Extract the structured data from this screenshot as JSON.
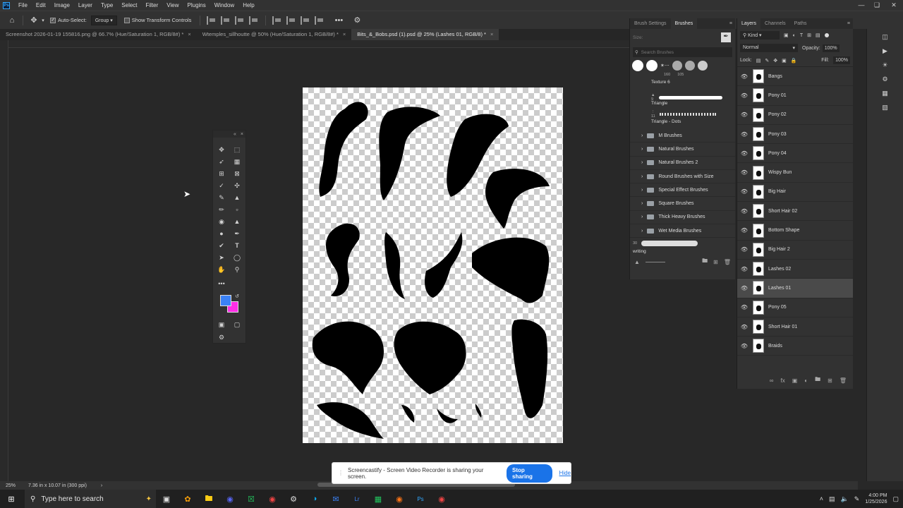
{
  "menu": {
    "logo": "Ps",
    "items": [
      "File",
      "Edit",
      "Image",
      "Layer",
      "Type",
      "Select",
      "Filter",
      "View",
      "Plugins",
      "Window",
      "Help"
    ]
  },
  "options_bar": {
    "auto_select_label": "Auto-Select:",
    "auto_select_target": "Group",
    "show_transform_label": "Show Transform Controls",
    "more_label": "•••"
  },
  "tabs": [
    {
      "label": "Screenshot 2026-01-19 155816.png @ 66.7% (Hue/Saturation 1, RGB/8#) *",
      "active": false
    },
    {
      "label": "Wtemples_sillhoutte @ 50% (Hue/Saturation 1, RGB/8#) *",
      "active": false
    },
    {
      "label": "Bits_&_Bobs.psd (1).psd @ 25% (Lashes 01, RGB/8) *",
      "active": true
    }
  ],
  "brushes": {
    "tabs": [
      "Brush Settings",
      "Brushes"
    ],
    "size_label": "Size:",
    "search_placeholder": "Search Brushes",
    "preset_sizes": [
      "160",
      "105"
    ],
    "texture_label": "Texture 6",
    "triangle_size": "9",
    "triangle_label": "Triangle",
    "dots_size": "11",
    "dots_label": "Triangle - Dots",
    "folders": [
      "M Brushes",
      "Natural Brushes",
      "Natural Brushes 2",
      "Round Brushes with Size",
      "Special Effect Brushes",
      "Square Brushes",
      "Thick Heavy Brushes",
      "Wet Media Brushes"
    ],
    "bottom_size": "30",
    "bottom_label": "writing"
  },
  "layers": {
    "tabs": [
      "Layers",
      "Channels",
      "Paths"
    ],
    "kind_label": "Kind",
    "blend_mode": "Normal",
    "opacity_label": "Opacity:",
    "opacity_value": "100%",
    "lock_label": "Lock:",
    "fill_label": "Fill:",
    "fill_value": "100%",
    "items": [
      {
        "name": "Bangs",
        "selected": false
      },
      {
        "name": "Pony 01",
        "selected": false
      },
      {
        "name": "Pony 02",
        "selected": false
      },
      {
        "name": "Pony 03",
        "selected": false
      },
      {
        "name": "Pony 04",
        "selected": false
      },
      {
        "name": "Wispy Bun",
        "selected": false
      },
      {
        "name": "Big Hair",
        "selected": false
      },
      {
        "name": "Short Hair 02",
        "selected": false
      },
      {
        "name": "Bottom Shape",
        "selected": false
      },
      {
        "name": "Big Hair 2",
        "selected": false
      },
      {
        "name": "Lashes 02",
        "selected": false
      },
      {
        "name": "Lashes 01",
        "selected": true
      },
      {
        "name": "Pony 05",
        "selected": false
      },
      {
        "name": "Short Hair 01",
        "selected": false
      },
      {
        "name": "Braids",
        "selected": false
      }
    ]
  },
  "status": {
    "zoom": "25%",
    "doc_size": "7.36 in x 10.07 in (300 ppi)"
  },
  "share_bar": {
    "message": "Screencastify - Screen Video Recorder is sharing your screen.",
    "stop_label": "Stop sharing",
    "hide_label": "Hide"
  },
  "taskbar": {
    "search_placeholder": "Type here to search",
    "time": "4:00 PM",
    "date": "1/25/2026"
  },
  "colors": {
    "foreground": "#3b82f6",
    "background": "#ff2ee6"
  }
}
